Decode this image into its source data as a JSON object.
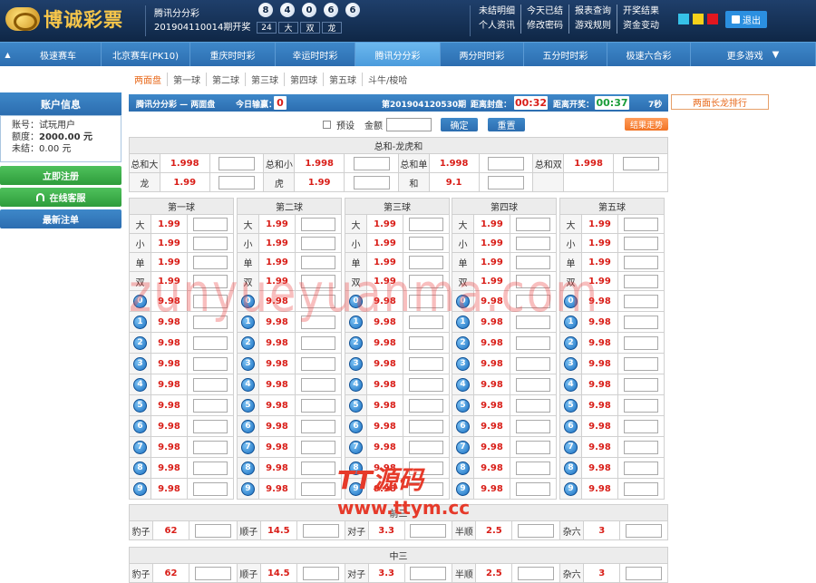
{
  "brand": {
    "name": "博诚彩票"
  },
  "header": {
    "game_name": "腾讯分分彩",
    "period_text": "201904110014期开奖",
    "balls": [
      "8",
      "4",
      "0",
      "6",
      "6"
    ],
    "result_cells": [
      "24",
      "大",
      "双",
      "龙"
    ],
    "links": [
      "未结明细",
      "今天已结",
      "报表查询",
      "开奖结果",
      "个人资讯",
      "修改密码",
      "游戏规则",
      "资金变动"
    ],
    "colors": [
      "#36c1e8",
      "#f6d11b",
      "#e2171f"
    ],
    "exit_label": "退出"
  },
  "nav": {
    "items": [
      "极速赛车",
      "北京赛车(PK10)",
      "重庆时时彩",
      "幸运时时彩",
      "腾讯分分彩",
      "两分时时彩",
      "五分时时彩",
      "极速六合彩",
      "更多游戏"
    ],
    "active": "腾讯分分彩",
    "more_arrow": "▼"
  },
  "subnav": [
    "两面盘",
    "第一球",
    "第二球",
    "第三球",
    "第四球",
    "第五球",
    "斗牛/梭哈"
  ],
  "sidebar": {
    "title": "账户信息",
    "account_label": "账号：",
    "account": "试玩用户",
    "limit_label": "额度：",
    "limit": "2000.00 元",
    "unsettled_label": "未结：",
    "unsettled": "0.00 元",
    "register": "立即注册",
    "service": "在线客服",
    "latest": "最新注单"
  },
  "bar": {
    "title": "腾讯分分彩 — 两面盘",
    "pnl_label": "今日输赢：",
    "pnl": "0",
    "period": "第201904120530期",
    "close_label": "距离封盘：",
    "close": "00:32",
    "open_label": "距离开奖：",
    "open": "00:37",
    "secs": "7秒"
  },
  "rank_label": "两面长龙排行",
  "controls": {
    "preset": "预设",
    "amount": "金额",
    "confirm": "确定",
    "reset": "重置"
  },
  "trend_label": "结果走势",
  "sum": {
    "title": "总和-龙虎和",
    "rows": [
      [
        {
          "l": "总和大",
          "o": "1.998"
        },
        {
          "l": "总和小",
          "o": "1.998"
        },
        {
          "l": "总和单",
          "o": "1.998"
        },
        {
          "l": "总和双",
          "o": "1.998"
        }
      ],
      [
        {
          "l": "龙",
          "o": "1.99"
        },
        {
          "l": "虎",
          "o": "1.99"
        },
        {
          "l": "和",
          "o": "9.1"
        }
      ]
    ]
  },
  "balls_section": {
    "headers": [
      "第一球",
      "第二球",
      "第三球",
      "第四球",
      "第五球"
    ],
    "bs_rows": [
      {
        "l": "大",
        "o": "1.99"
      },
      {
        "l": "小",
        "o": "1.99"
      },
      {
        "l": "单",
        "o": "1.99"
      },
      {
        "l": "双",
        "o": "1.99"
      }
    ],
    "digit_rows": [
      {
        "l": "0",
        "o": "9.98"
      },
      {
        "l": "1",
        "o": "9.98"
      },
      {
        "l": "2",
        "o": "9.98"
      },
      {
        "l": "3",
        "o": "9.98"
      },
      {
        "l": "4",
        "o": "9.98"
      },
      {
        "l": "5",
        "o": "9.98"
      },
      {
        "l": "6",
        "o": "9.98"
      },
      {
        "l": "7",
        "o": "9.98"
      },
      {
        "l": "8",
        "o": "9.98"
      },
      {
        "l": "9",
        "o": "9.98"
      }
    ]
  },
  "front3": {
    "title": "前三",
    "items": [
      {
        "l": "豹子",
        "o": "62"
      },
      {
        "l": "顺子",
        "o": "14.5"
      },
      {
        "l": "对子",
        "o": "3.3"
      },
      {
        "l": "半顺",
        "o": "2.5"
      },
      {
        "l": "杂六",
        "o": "3"
      }
    ]
  },
  "mid3": {
    "title": "中三",
    "items": [
      {
        "l": "豹子",
        "o": "62"
      },
      {
        "l": "顺子",
        "o": "14.5"
      },
      {
        "l": "对子",
        "o": "3.3"
      },
      {
        "l": "半顺",
        "o": "2.5"
      },
      {
        "l": "杂六",
        "o": "3"
      }
    ]
  },
  "watermark": {
    "text": "zunyueyuanma.com",
    "brand": "TT源码",
    "url": "www.ttym.cc"
  }
}
